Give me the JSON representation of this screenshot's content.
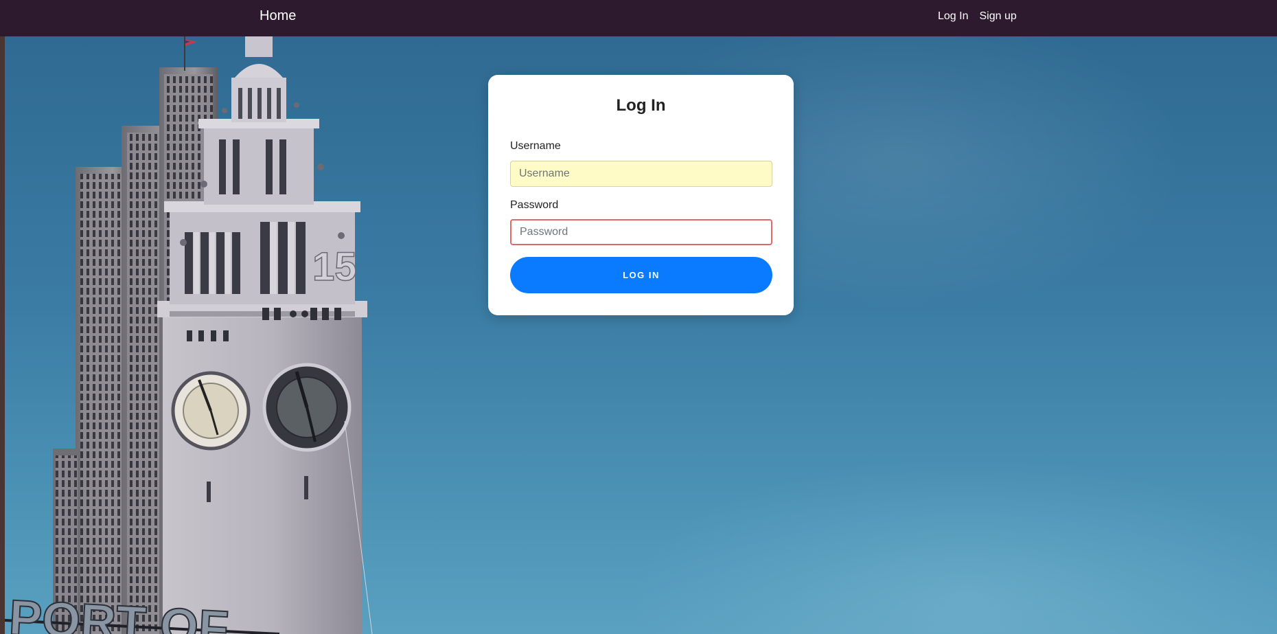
{
  "navbar": {
    "brand": "Home",
    "links": [
      {
        "label": "Log In"
      },
      {
        "label": "Sign up"
      }
    ]
  },
  "login_card": {
    "title": "Log In",
    "username": {
      "label": "Username",
      "placeholder": "Username",
      "value": ""
    },
    "password": {
      "label": "Password",
      "placeholder": "Password",
      "value": ""
    },
    "submit_label": "LOG IN"
  },
  "hero": {
    "sign_text": "PORT OF",
    "tower_number": "15"
  },
  "colors": {
    "navbar": "#2e1a2e",
    "primary_button": "#0a7bff",
    "autofill_field": "#fefbc7",
    "invalid_border": "#e06a6a",
    "sky": "#3b7ca4"
  }
}
